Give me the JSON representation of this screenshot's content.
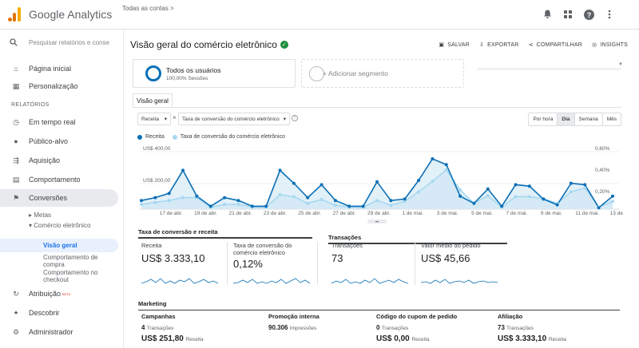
{
  "app": {
    "title": "Google Analytics",
    "breadcrumb": "Todas as contas",
    "breadcrumb_arrow": ">"
  },
  "sidebar": {
    "search_placeholder": "Pesquisar relatórios e conse",
    "items": [
      {
        "label": "Página inicial",
        "icon": "home-icon"
      },
      {
        "label": "Personalização",
        "icon": "dashboard-icon"
      }
    ],
    "section_label": "RELATÓRIOS",
    "reports": [
      {
        "label": "Em tempo real",
        "icon": "clock-icon"
      },
      {
        "label": "Público-alvo",
        "icon": "person-icon"
      },
      {
        "label": "Aquisição",
        "icon": "acquisition-icon"
      },
      {
        "label": "Comportamento",
        "icon": "behavior-icon"
      },
      {
        "label": "Conversões",
        "icon": "flag-icon"
      }
    ],
    "sub_goals": "Metas",
    "sub_ecommerce": "Comércio eletrônico",
    "sub_overview": "Visão geral",
    "sub_shopping": "Comportamento de compra",
    "sub_checkout": "Comportamento no checkout",
    "bottom": [
      {
        "label": "Atribuição",
        "icon": "attribution-icon",
        "badge": "BETA"
      },
      {
        "label": "Descobrir",
        "icon": "lightbulb-icon"
      },
      {
        "label": "Administrador",
        "icon": "gear-icon"
      }
    ]
  },
  "header": {
    "title": "Visão geral do comércio eletrônico",
    "actions": {
      "save": "SALVAR",
      "export": "EXPORTAR",
      "share": "COMPARTILHAR",
      "insights": "INSIGHTS"
    }
  },
  "segments": {
    "active_name": "Todos os usuários",
    "active_sub": "100,00% Sessões",
    "add": "+ Adicionar segmento"
  },
  "tab": "Visão geral",
  "controls": {
    "metric1": "Receita",
    "metric2": "Taxa de conversão do comércio eletrônico",
    "x": "×",
    "help": "?",
    "granularity": [
      "Por hora",
      "Dia",
      "Semana",
      "Mês"
    ],
    "granularity_selected": "Dia"
  },
  "chart_data": {
    "type": "area",
    "series": [
      {
        "name": "Receita",
        "color": "#0b6fb6",
        "values": [
          60,
          80,
          110,
          270,
          90,
          20,
          80,
          60,
          20,
          20,
          270,
          180,
          80,
          170,
          60,
          20,
          20,
          190,
          60,
          70,
          200,
          350,
          310,
          90,
          40,
          140,
          20,
          170,
          160,
          70,
          30,
          180,
          170,
          10,
          90
        ]
      },
      {
        "name": "Taxa de conversão do comércio eletrônico",
        "color": "#a8d8f0",
        "values": [
          0.05,
          0.07,
          0.09,
          0.12,
          0.12,
          0.02,
          0.05,
          0.05,
          0.02,
          0.02,
          0.15,
          0.13,
          0.06,
          0.1,
          0.04,
          0.02,
          0.02,
          0.09,
          0.04,
          0.08,
          0.18,
          0.29,
          0.41,
          0.2,
          0.06,
          0.14,
          0.02,
          0.13,
          0.13,
          0.11,
          0.06,
          0.18,
          0.22,
          0.02,
          0.08
        ]
      }
    ],
    "y_left_ticks": [
      "US$ 400,00",
      "US$ 200,00"
    ],
    "y_right_ticks": [
      "0,60%",
      "0,40%",
      "0,20%"
    ],
    "ylim_left": [
      0,
      400
    ],
    "ylim_right": [
      0,
      0.6
    ],
    "x_ticks": [
      "17 de abr.",
      "19 de abr.",
      "21 de abr.",
      "23 de abr.",
      "25 de abr.",
      "27 de abr.",
      "29 de abr.",
      "1 de mai.",
      "3 de mai.",
      "5 de mai.",
      "7 de mai.",
      "9 de mai.",
      "11 de mai.",
      "13 de"
    ]
  },
  "metrics": {
    "group1_title": "Taxa de conversão e receita",
    "group2_title": "Transações",
    "boxes": [
      {
        "label": "Receita",
        "value": "US$ 3.333,10"
      },
      {
        "label": "Taxa de conversão do comércio eletrônico",
        "value": "0,12%"
      },
      {
        "label": "Transações",
        "value": "73"
      },
      {
        "label": "Valor médio do pedido",
        "value": "US$ 45,66"
      }
    ]
  },
  "marketing": {
    "title": "Marketing",
    "cols": [
      {
        "head": "Campanhas",
        "count": "4",
        "count_unit": "Transações",
        "money": "US$ 251,80",
        "money_unit": "Receita"
      },
      {
        "head": "Promoção interna",
        "count": "90.306",
        "count_unit": "Impressões",
        "money": "",
        "money_unit": ""
      },
      {
        "head": "Código do cupom de pedido",
        "count": "0",
        "count_unit": "Transações",
        "money": "US$ 0,00",
        "money_unit": "Receita"
      },
      {
        "head": "Afiliação",
        "count": "73",
        "count_unit": "Transações",
        "money": "US$ 3.333,10",
        "money_unit": "Receita"
      }
    ]
  },
  "colors": {
    "accent": "#1a73e8",
    "series1": "#0b6fb6",
    "series2": "#a8d8f0"
  }
}
